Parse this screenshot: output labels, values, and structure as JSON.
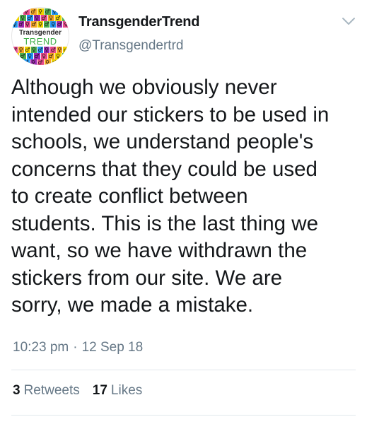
{
  "tweet": {
    "display_name": "TransgenderTrend",
    "handle": "@Transgendertrd",
    "text": "Although we obviously never\nintended our stickers to be used in\nschools, we understand people's\nconcerns that they could be used\nto create conflict between\nstudents. This is the last thing we\nwant, so we have withdrawn the\nstickers from our site. We are\nsorry, we made a mistake.",
    "time": "10:23 pm",
    "date": "12 Sep 18",
    "separator": "·",
    "retweets_count": "3",
    "retweets_label": "Retweets",
    "likes_count": "17",
    "likes_label": "Likes"
  },
  "avatar": {
    "logo_word_1": "Transgender",
    "logo_word_2": "TREND",
    "symbol_colors": [
      "#e84a8a",
      "#f5a623",
      "#f0d400",
      "#4caf50",
      "#2196f3",
      "#9c27b0"
    ]
  },
  "icons": {
    "chevron": "chevron-down-icon"
  },
  "colors": {
    "text": "#14171a",
    "secondary": "#657786",
    "divider": "#e1e8ed"
  }
}
